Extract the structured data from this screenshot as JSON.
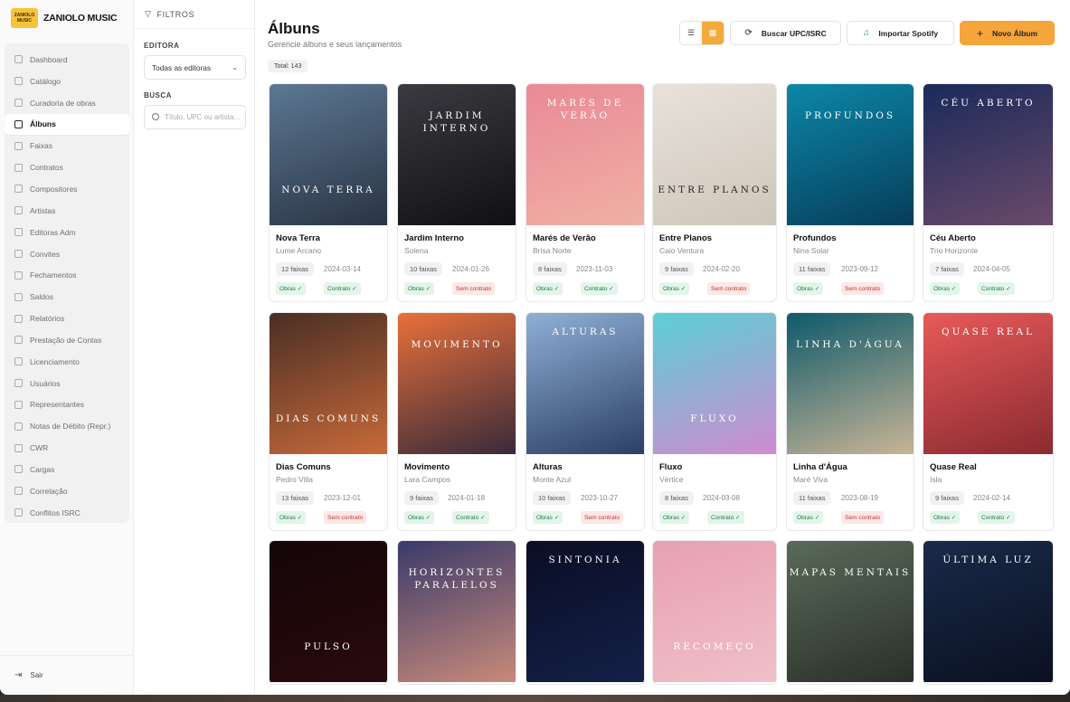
{
  "brand": {
    "logo_text": "ZANIOLO MUSIC",
    "name": "ZANIOLO MUSIC"
  },
  "nav": [
    {
      "label": "Dashboard",
      "icon": "grid-icon"
    },
    {
      "label": "Catálogo",
      "icon": "library-icon"
    },
    {
      "label": "Curadoria de obras",
      "icon": "check-list-icon"
    },
    {
      "label": "Álbuns",
      "icon": "album-icon",
      "active": true
    },
    {
      "label": "Faixas",
      "icon": "disc-icon"
    },
    {
      "label": "Contratos",
      "icon": "document-icon"
    },
    {
      "label": "Compositores",
      "icon": "pen-icon"
    },
    {
      "label": "Artistas",
      "icon": "music-note-icon"
    },
    {
      "label": "Editoras Adm",
      "icon": "building-icon"
    },
    {
      "label": "Convites",
      "icon": "mail-icon"
    },
    {
      "label": "Fechamentos",
      "icon": "lock-icon"
    },
    {
      "label": "Saldos",
      "icon": "wallet-icon"
    },
    {
      "label": "Relatórios",
      "icon": "report-icon"
    },
    {
      "label": "Prestação de Contas",
      "icon": "calculator-icon"
    },
    {
      "label": "Licenciamento",
      "icon": "license-icon"
    },
    {
      "label": "Usuários",
      "icon": "user-icon"
    },
    {
      "label": "Representantes",
      "icon": "users-icon"
    },
    {
      "label": "Notas de Débito (Repr.)",
      "icon": "receipt-icon"
    },
    {
      "label": "CWR",
      "icon": "file-code-icon"
    },
    {
      "label": "Cargas",
      "icon": "upload-icon"
    },
    {
      "label": "Correlação",
      "icon": "link-icon"
    },
    {
      "label": "Conflitos ISRC",
      "icon": "alert-icon"
    }
  ],
  "logout_label": "Sair",
  "filters": {
    "title": "FILTROS",
    "editora_label": "EDITORA",
    "editora_value": "Todas as editoras",
    "busca_label": "BUSCA",
    "busca_placeholder": "Título, UPC ou artista..."
  },
  "header": {
    "title": "Álbuns",
    "subtitle": "Gerencie álbuns e seus lançamentos",
    "total": "Total: 143",
    "buttons": {
      "search_upc": "Buscar UPC/ISRC",
      "import_spotify": "Importar Spotify",
      "new_album": "Novo Álbum"
    }
  },
  "badges": {
    "obras": "Obras ✓",
    "contrato_ok": "Contrato ✓",
    "contrato_no": "Sem contrato"
  },
  "albums": [
    {
      "title": "Nova Terra",
      "artist": "Lume Arcano",
      "tracks": "12 faixas",
      "date": "2024-03-14",
      "contract": true,
      "cover_text": "NOVA TERRA",
      "colors": [
        "#5c7893",
        "#2a3444"
      ]
    },
    {
      "title": "Jardim Interno",
      "artist": "Solena",
      "tracks": "10 faixas",
      "date": "2024-01-26",
      "contract": false,
      "cover_text": "JARDIM INTERNO",
      "colors": [
        "#3a3a40",
        "#101014"
      ]
    },
    {
      "title": "Marés de Verão",
      "artist": "Brisa Norte",
      "tracks": "8 faixas",
      "date": "2023-11-03",
      "contract": true,
      "cover_text": "MARÉS DE VERÃO",
      "colors": [
        "#e98a96",
        "#f0b0a4"
      ]
    },
    {
      "title": "Entre Planos",
      "artist": "Caio Ventura",
      "tracks": "9 faixas",
      "date": "2024-02-20",
      "contract": false,
      "cover_text": "ENTRE PLANOS",
      "colors": [
        "#e8e2da",
        "#cfc6ba"
      ]
    },
    {
      "title": "Profundos",
      "artist": "Nina Solar",
      "tracks": "11 faixas",
      "date": "2023-09-12",
      "contract": false,
      "cover_text": "PROFUNDOS",
      "colors": [
        "#0d87a8",
        "#063d5a"
      ]
    },
    {
      "title": "Céu Aberto",
      "artist": "Trio Horizonte",
      "tracks": "7 faixas",
      "date": "2024-04-05",
      "contract": true,
      "cover_text": "CÉU ABERTO",
      "colors": [
        "#1a2a5a",
        "#6a4a6a"
      ]
    },
    {
      "title": "Dias Comuns",
      "artist": "Pedro Villa",
      "tracks": "13 faixas",
      "date": "2023-12-01",
      "contract": false,
      "cover_text": "DIAS COMUNS",
      "colors": [
        "#4a2e24",
        "#c86a3a"
      ]
    },
    {
      "title": "Movimento",
      "artist": "Lara Campos",
      "tracks": "9 faixas",
      "date": "2024-01-18",
      "contract": true,
      "cover_text": "MOVIMENTO",
      "colors": [
        "#e8703a",
        "#3a2a3a"
      ]
    },
    {
      "title": "Alturas",
      "artist": "Monte Azul",
      "tracks": "10 faixas",
      "date": "2023-10-27",
      "contract": false,
      "cover_text": "ALTURAS",
      "colors": [
        "#8fb0d6",
        "#2c3f64"
      ]
    },
    {
      "title": "Fluxo",
      "artist": "Vértice",
      "tracks": "8 faixas",
      "date": "2024-03-08",
      "contract": true,
      "cover_text": "FLUXO",
      "colors": [
        "#5ad0d4",
        "#d08ad0"
      ]
    },
    {
      "title": "Linha d'Água",
      "artist": "Maré Viva",
      "tracks": "11 faixas",
      "date": "2023-08-19",
      "contract": false,
      "cover_text": "LINHA D'ÁGUA",
      "colors": [
        "#0e5a6a",
        "#c8b496"
      ]
    },
    {
      "title": "Quase Real",
      "artist": "Isla",
      "tracks": "9 faixas",
      "date": "2024-02-14",
      "contract": true,
      "cover_text": "QUASE REAL",
      "colors": [
        "#e85a5a",
        "#8a2a30"
      ]
    },
    {
      "title": "",
      "artist": "",
      "tracks": "",
      "date": "",
      "contract": null,
      "cover_text": "PULSO",
      "colors": [
        "#140608",
        "#2a0a0c"
      ]
    },
    {
      "title": "",
      "artist": "",
      "tracks": "",
      "date": "",
      "contract": null,
      "cover_text": "HORIZONTES PARALELOS",
      "colors": [
        "#3a3a6a",
        "#c88a7a"
      ]
    },
    {
      "title": "",
      "artist": "",
      "tracks": "",
      "date": "",
      "contract": null,
      "cover_text": "SINTONIA",
      "colors": [
        "#0a0e24",
        "#142048"
      ]
    },
    {
      "title": "",
      "artist": "",
      "tracks": "",
      "date": "",
      "contract": null,
      "cover_text": "RECOMEÇO",
      "colors": [
        "#e8a0b0",
        "#f0c0c8"
      ]
    },
    {
      "title": "",
      "artist": "",
      "tracks": "",
      "date": "",
      "contract": null,
      "cover_text": "MAPAS MENTAIS",
      "colors": [
        "#5a6a5a",
        "#2a3028"
      ]
    },
    {
      "title": "",
      "artist": "",
      "tracks": "",
      "date": "",
      "contract": null,
      "cover_text": "ÚLTIMA LUZ",
      "colors": [
        "#1a2a4a",
        "#0a1020"
      ]
    }
  ]
}
